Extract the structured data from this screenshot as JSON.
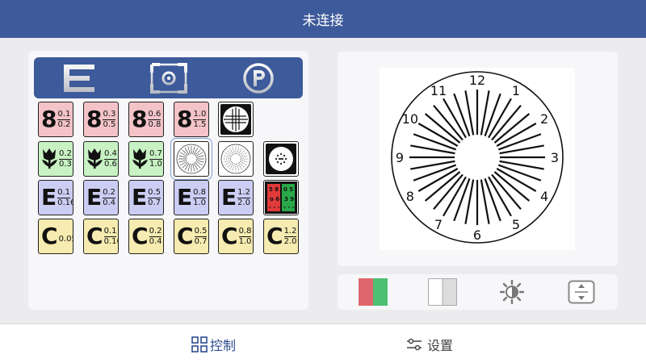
{
  "header": {
    "title": "未连接"
  },
  "mode_bar": {
    "modes": [
      {
        "name": "letter-e-mode",
        "glyph": "E"
      },
      {
        "name": "camera-mode",
        "glyph": ""
      },
      {
        "name": "parking-mode",
        "glyph": "P"
      }
    ]
  },
  "tiles": [
    {
      "name": "tile-8-0.1-0.2",
      "kind": "frac",
      "color": "pink",
      "big": "8",
      "top": "0.1",
      "bottom": "0.2"
    },
    {
      "name": "tile-8-0.3-0.5",
      "kind": "frac",
      "color": "pink",
      "big": "8",
      "top": "0.3",
      "bottom": "0.5"
    },
    {
      "name": "tile-8-0.6-0.8",
      "kind": "frac",
      "color": "pink",
      "big": "8",
      "top": "0.6",
      "bottom": "0.8"
    },
    {
      "name": "tile-8-1.0-1.5",
      "kind": "frac",
      "color": "pink",
      "big": "8",
      "top": "1.0",
      "bottom": "1.5"
    },
    {
      "name": "tile-cross-grid",
      "kind": "icon",
      "icon": "cross-grid"
    },
    {
      "name": "tile-tulip-0.2-0.3",
      "kind": "tulip",
      "color": "green",
      "top": "0.2",
      "bottom": "0.3"
    },
    {
      "name": "tile-tulip-0.4-0.6",
      "kind": "tulip",
      "color": "green",
      "top": "0.4",
      "bottom": "0.6"
    },
    {
      "name": "tile-tulip-0.7-1.0",
      "kind": "tulip",
      "color": "green",
      "top": "0.7",
      "bottom": "1.0"
    },
    {
      "name": "tile-astigmatism-dial",
      "kind": "icon",
      "icon": "dial-small",
      "selected": true
    },
    {
      "name": "tile-dial-dotted",
      "kind": "icon",
      "icon": "dial-dotted"
    },
    {
      "name": "tile-dot-circle",
      "kind": "icon",
      "icon": "dot-circle"
    },
    {
      "name": "tile-e-0.1-0.16",
      "kind": "frac",
      "color": "lav",
      "big": "E",
      "top": "0.1",
      "bottom": "0.16"
    },
    {
      "name": "tile-e-0.2-0.4",
      "kind": "frac",
      "color": "lav",
      "big": "E",
      "top": "0.2",
      "bottom": "0.4"
    },
    {
      "name": "tile-e-0.5-0.7",
      "kind": "frac",
      "color": "lav",
      "big": "E",
      "top": "0.5",
      "bottom": "0.7"
    },
    {
      "name": "tile-e-0.8-1.0",
      "kind": "frac",
      "color": "lav",
      "big": "E",
      "top": "0.8",
      "bottom": "1.0"
    },
    {
      "name": "tile-e-1.2-2.0",
      "kind": "frac",
      "color": "lav",
      "big": "E",
      "top": "1.2",
      "bottom": "2.0"
    },
    {
      "name": "tile-red-green",
      "kind": "icon",
      "icon": "red-green"
    },
    {
      "name": "tile-c-0.05",
      "kind": "single",
      "color": "cream",
      "big": "C",
      "single": "0.05"
    },
    {
      "name": "tile-c-0.1-0.16",
      "kind": "frac",
      "color": "cream",
      "big": "C",
      "top": "0.1",
      "bottom": "0.16"
    },
    {
      "name": "tile-c-0.2-0.4",
      "kind": "frac",
      "color": "cream",
      "big": "C",
      "top": "0.2",
      "bottom": "0.4"
    },
    {
      "name": "tile-c-0.5-0.7",
      "kind": "frac",
      "color": "cream",
      "big": "C",
      "top": "0.5",
      "bottom": "0.7"
    },
    {
      "name": "tile-c-0.8-1.0",
      "kind": "frac",
      "color": "cream",
      "big": "C",
      "top": "0.8",
      "bottom": "1.0"
    },
    {
      "name": "tile-c-1.2-2.0",
      "kind": "frac",
      "color": "cream",
      "big": "C",
      "top": "1.2",
      "bottom": "2.0"
    }
  ],
  "preview": {
    "clock_numbers": [
      "12",
      "1",
      "2",
      "3",
      "4",
      "5",
      "6",
      "7",
      "8",
      "9",
      "10",
      "11"
    ]
  },
  "tools": [
    {
      "name": "red-green-toggle-icon"
    },
    {
      "name": "white-gray-toggle-icon"
    },
    {
      "name": "brightness-icon"
    },
    {
      "name": "fit-screen-icon"
    }
  ],
  "nav": {
    "control": {
      "label": "控制",
      "icon": "grid-icon"
    },
    "settings": {
      "label": "设置",
      "icon": "sliders-icon"
    }
  },
  "colors": {
    "header": "#3d5a9a",
    "active_nav": "#2e4d8f",
    "pink": "#f3c3c8",
    "green": "#c8f2c3",
    "lavender": "#cbcdf3",
    "cream": "#f6ebb0"
  }
}
